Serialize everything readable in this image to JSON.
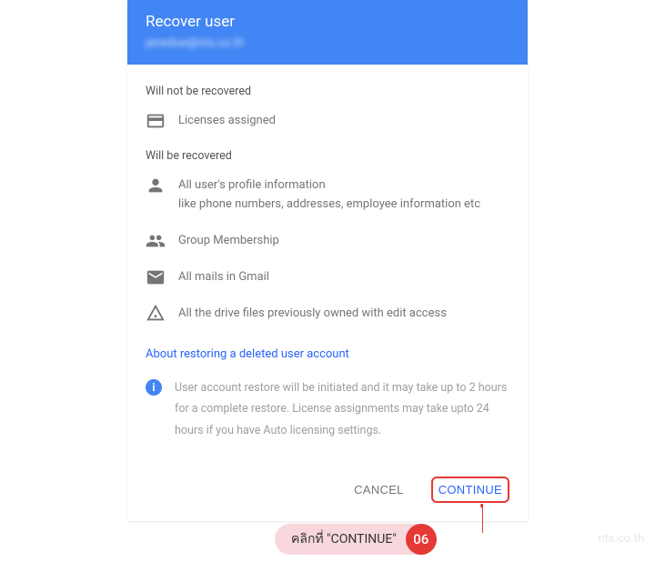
{
  "header": {
    "title": "Recover user",
    "email": "janedoe@nts.co.th"
  },
  "sections": {
    "not_recovered_title": "Will not be recovered",
    "recovered_title": "Will be recovered",
    "licenses": "Licenses assigned",
    "profile_line1": "All user's profile information",
    "profile_line2": "like phone numbers, addresses, employee information etc",
    "group": "Group Membership",
    "mails": "All mails in Gmail",
    "drive": "All the drive files previously owned with edit access"
  },
  "link_text": "About restoring a deleted user account",
  "info_text": "User account restore will be initiated and it may take up to 2 hours for a complete restore. License assignments may take upto 24 hours if you have Auto licensing settings.",
  "buttons": {
    "cancel": "CANCEL",
    "continue": "CONTINUE"
  },
  "annotation": {
    "text": "คลิกที่ \"CONTINUE\"",
    "number": "06"
  },
  "watermark": "nts.co.th"
}
